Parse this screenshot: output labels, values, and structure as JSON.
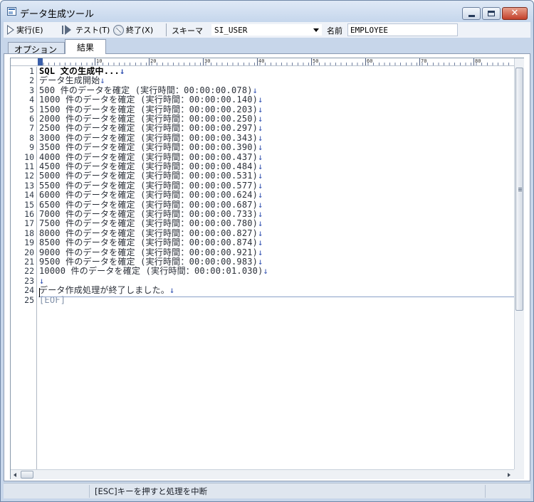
{
  "window": {
    "title": "データ生成ツール",
    "close_symbol": "✕"
  },
  "toolbar": {
    "run_label": "実行(E)",
    "test_label": "テスト(T)",
    "quit_label": "終了(X)",
    "schema_label": "スキーマ",
    "schema_value": "SI_USER",
    "name_label": "名前",
    "name_value": "EMPLOYEE"
  },
  "tabs": [
    {
      "label": "オプション",
      "active": false
    },
    {
      "label": "結果",
      "active": true
    }
  ],
  "ruler": {
    "marks": [
      "0",
      "10",
      "20",
      "30",
      "40",
      "50",
      "60",
      "70",
      "80"
    ]
  },
  "editor": {
    "eol_marker": "↓",
    "lines": [
      {
        "no": "1",
        "text": "SQL 文の生成中...",
        "eol": true,
        "bold": true
      },
      {
        "no": "2",
        "text": "データ生成開始",
        "eol": true
      },
      {
        "no": "3",
        "text": "500 件のデータを確定 (実行時間：00:00:00.078)",
        "eol": true
      },
      {
        "no": "4",
        "text": "1000 件のデータを確定 (実行時間：00:00:00.140)",
        "eol": true
      },
      {
        "no": "5",
        "text": "1500 件のデータを確定 (実行時間：00:00:00.203)",
        "eol": true
      },
      {
        "no": "6",
        "text": "2000 件のデータを確定 (実行時間：00:00:00.250)",
        "eol": true
      },
      {
        "no": "7",
        "text": "2500 件のデータを確定 (実行時間：00:00:00.297)",
        "eol": true
      },
      {
        "no": "8",
        "text": "3000 件のデータを確定 (実行時間：00:00:00.343)",
        "eol": true
      },
      {
        "no": "9",
        "text": "3500 件のデータを確定 (実行時間：00:00:00.390)",
        "eol": true
      },
      {
        "no": "10",
        "text": "4000 件のデータを確定 (実行時間：00:00:00.437)",
        "eol": true
      },
      {
        "no": "11",
        "text": "4500 件のデータを確定 (実行時間：00:00:00.484)",
        "eol": true
      },
      {
        "no": "12",
        "text": "5000 件のデータを確定 (実行時間：00:00:00.531)",
        "eol": true
      },
      {
        "no": "13",
        "text": "5500 件のデータを確定 (実行時間：00:00:00.577)",
        "eol": true
      },
      {
        "no": "14",
        "text": "6000 件のデータを確定 (実行時間：00:00:00.624)",
        "eol": true
      },
      {
        "no": "15",
        "text": "6500 件のデータを確定 (実行時間：00:00:00.687)",
        "eol": true
      },
      {
        "no": "16",
        "text": "7000 件のデータを確定 (実行時間：00:00:00.733)",
        "eol": true
      },
      {
        "no": "17",
        "text": "7500 件のデータを確定 (実行時間：00:00:00.780)",
        "eol": true
      },
      {
        "no": "18",
        "text": "8000 件のデータを確定 (実行時間：00:00:00.827)",
        "eol": true
      },
      {
        "no": "19",
        "text": "8500 件のデータを確定 (実行時間：00:00:00.874)",
        "eol": true
      },
      {
        "no": "20",
        "text": "9000 件のデータを確定 (実行時間：00:00:00.921)",
        "eol": true
      },
      {
        "no": "21",
        "text": "9500 件のデータを確定 (実行時間：00:00:00.983)",
        "eol": true
      },
      {
        "no": "22",
        "text": "10000 件のデータを確定 (実行時間：00:00:01.030)",
        "eol": true
      },
      {
        "no": "23",
        "text": "",
        "eol": true
      },
      {
        "no": "24",
        "text": "データ作成処理が終了しました。",
        "eol": true
      },
      {
        "no": "25",
        "text": "[EOF]",
        "eol": false,
        "eof": true
      }
    ]
  },
  "status": {
    "message": "[ESC]キーを押すと処理を中断"
  }
}
